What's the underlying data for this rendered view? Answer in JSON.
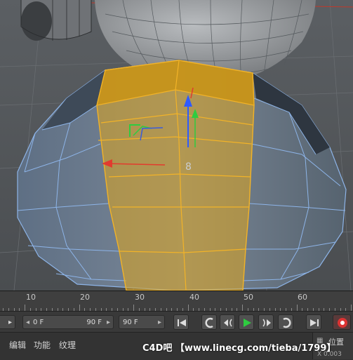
{
  "viewport": {
    "object_label": "8"
  },
  "timeline": {
    "ruler_labels": [
      "10",
      "20",
      "30",
      "40",
      "50",
      "60"
    ],
    "start_frame": "0 F",
    "end_frame_slider": "90 F",
    "max_frame": "90 F"
  },
  "menu": {
    "items": [
      "编辑",
      "功能",
      "纹理"
    ]
  },
  "watermark": "C4D吧 【www.linecg.com/tieba/1799】",
  "attributes": {
    "title": "位置",
    "value": "X  0.003"
  },
  "colors": {
    "selection": "#e0a51c",
    "wire": "#8db4e8",
    "play": "#2ecc40"
  }
}
